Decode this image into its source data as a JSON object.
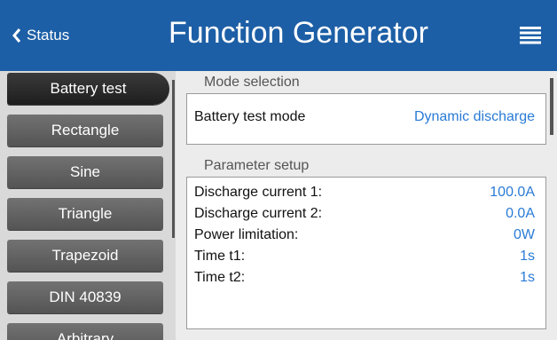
{
  "header": {
    "back_label": "Status",
    "title": "Function Generator",
    "back_icon": "chevron-left-icon",
    "menu_icon": "hamburger-menu-icon"
  },
  "sidebar": {
    "items": [
      {
        "label": "Battery test",
        "active": true
      },
      {
        "label": "Rectangle",
        "active": false
      },
      {
        "label": "Sine",
        "active": false
      },
      {
        "label": "Triangle",
        "active": false
      },
      {
        "label": "Trapezoid",
        "active": false
      },
      {
        "label": "DIN 40839",
        "active": false
      },
      {
        "label": "Arbitrary",
        "active": false
      }
    ]
  },
  "mode_selection": {
    "heading": "Mode selection",
    "label": "Battery test mode",
    "value": "Dynamic discharge"
  },
  "parameter_setup": {
    "heading": "Parameter setup",
    "rows": [
      {
        "label": "Discharge current 1:",
        "value": "100.0A"
      },
      {
        "label": "Discharge current 2:",
        "value": "0.0A"
      },
      {
        "label": "Power limitation:",
        "value": "0W"
      },
      {
        "label": "Time t1:",
        "value": "1s"
      },
      {
        "label": "Time t2:",
        "value": "1s"
      }
    ]
  },
  "colors": {
    "header_bg": "#1d5fa6",
    "value_text": "#2a7bd6",
    "active_button": "#2a2a2a",
    "button": "#636363"
  }
}
